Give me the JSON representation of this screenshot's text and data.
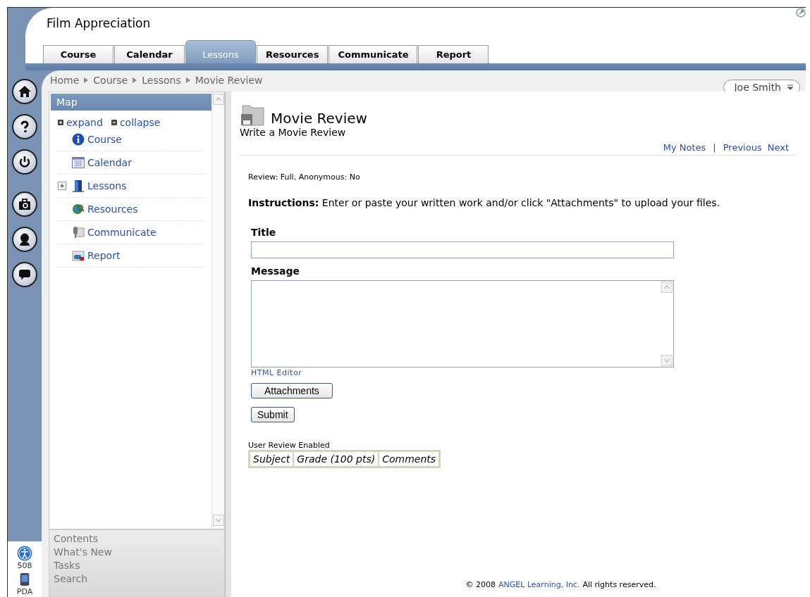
{
  "course_title": "Film Appreciation",
  "tabs": [
    {
      "label": "Course",
      "selected": false
    },
    {
      "label": "Calendar",
      "selected": false
    },
    {
      "label": "Lessons",
      "selected": true
    },
    {
      "label": "Resources",
      "selected": false
    },
    {
      "label": "Communicate",
      "selected": false
    },
    {
      "label": "Report",
      "selected": false
    }
  ],
  "breadcrumb": [
    "Home",
    "Course",
    "Lessons",
    "Movie Review"
  ],
  "user_menu": {
    "label": "Joe Smith"
  },
  "rail_bottom": [
    {
      "kind": "accessibility",
      "label": "508"
    },
    {
      "kind": "pda",
      "label": "PDA"
    }
  ],
  "sidebar": {
    "title": "Map",
    "expand": "expand",
    "collapse": "collapse",
    "items": [
      {
        "kind": "info",
        "label": "Course",
        "expandable": false
      },
      {
        "kind": "calendar",
        "label": "Calendar",
        "expandable": false
      },
      {
        "kind": "lessons",
        "label": "Lessons",
        "expandable": true
      },
      {
        "kind": "resources",
        "label": "Resources",
        "expandable": false
      },
      {
        "kind": "communicate",
        "label": "Communicate",
        "expandable": false
      },
      {
        "kind": "report",
        "label": "Report",
        "expandable": false
      }
    ],
    "footer_links": [
      "Contents",
      "What's New",
      "Tasks",
      "Search"
    ]
  },
  "main": {
    "title": "Movie Review",
    "subtitle": "Write a Movie Review",
    "nav": {
      "my_notes": "My Notes",
      "separator": "|",
      "previous": "Previous",
      "next": "Next"
    },
    "review_info": "Review: Full, Anonymous: No",
    "instructions": "**Instructions:** Enter or paste your written work and/or click \"Attachments\" to upload your files.",
    "title_label": "Title",
    "message_label": "Message",
    "html_editor": "HTML Editor",
    "buttons": [
      "Attachments",
      "Submit"
    ],
    "review_table": {
      "caption": "User Review Enabled",
      "columns": [
        "Subject",
        "Grade (100 pts)",
        "Comments"
      ]
    },
    "copyright": {
      "before": "© 2008",
      "link": "ANGEL Learning, Inc.",
      "after": "All rights reserved."
    }
  }
}
